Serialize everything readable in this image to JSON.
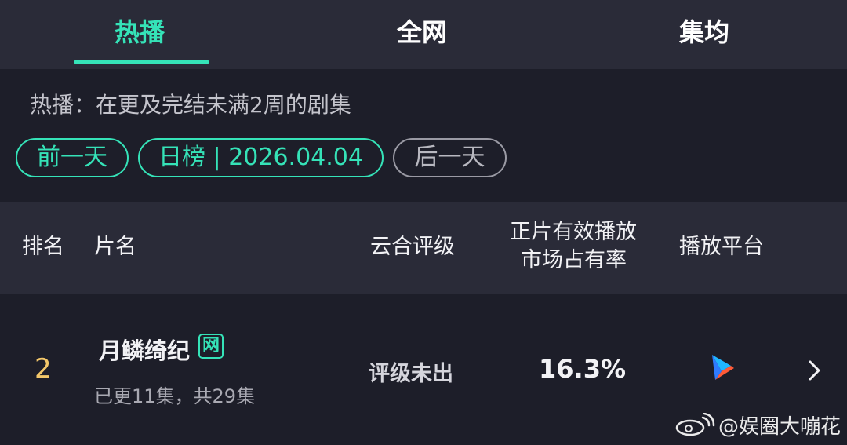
{
  "tabs": [
    {
      "label": "热播",
      "active": true
    },
    {
      "label": "全网",
      "active": false
    },
    {
      "label": "集均",
      "active": false
    }
  ],
  "description": "热播：在更及完结未满2周的剧集",
  "date_nav": {
    "prev_label": "前一天",
    "current_label": "日榜 | 2026.04.04",
    "next_label": "后一天"
  },
  "table": {
    "headers": {
      "rank": "排名",
      "title": "片名",
      "rating": "云合评级",
      "share_line1": "正片有效播放",
      "share_line2": "市场占有率",
      "platform": "播放平台"
    },
    "rows": [
      {
        "rank": "2",
        "title": "月鳞绮纪",
        "badge": "网",
        "episodes": "已更11集，共29集",
        "rating": "评级未出",
        "share": "16.3%",
        "platform_icon": "youku-play-icon"
      }
    ]
  },
  "watermark": {
    "text": "@娱圈大嘣花",
    "icon": "weibo-icon"
  },
  "colors": {
    "accent": "#35e3b8",
    "background": "#1d1e29",
    "panel": "#2a2b38",
    "rank": "#f3c76a"
  }
}
